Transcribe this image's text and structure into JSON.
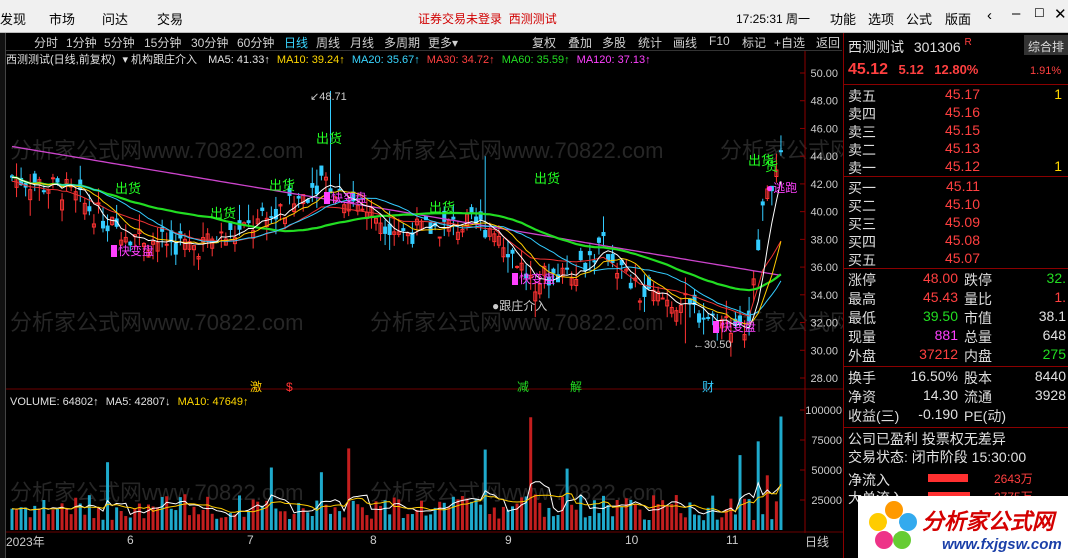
{
  "menubar": {
    "items": [
      "发现",
      "市场",
      "问达",
      "交易"
    ],
    "warning": "证券交易未登录",
    "stock_name": "西测测试",
    "clock": "17:25:31 周一",
    "right_items": [
      "功能",
      "选项",
      "公式",
      "版面"
    ]
  },
  "toolbar": {
    "periods": [
      "分时",
      "1分钟",
      "5分钟",
      "15分钟",
      "30分钟",
      "60分钟",
      "日线",
      "周线",
      "月线",
      "多周期",
      "更多▾"
    ],
    "active": "日线",
    "tools": [
      "复权",
      "叠加",
      "多股",
      "统计",
      "画线",
      "F10",
      "标记",
      "+自选",
      "返回"
    ]
  },
  "ma_line": {
    "title": "西测测试(日线,前复权)",
    "indicator": "机构跟庄介入",
    "ma5": "MA5: 41.33↑",
    "ma10": "MA10: 39.24↑",
    "ma20": "MA20: 35.67↑",
    "ma30": "MA30: 34.72↑",
    "ma60": "MA60: 35.59↑",
    "ma120": "MA120: 37.13↑"
  },
  "volume_line": {
    "volume": "VOLUME: 64802↑",
    "ma5": "MA5: 42807↓",
    "ma10": "MA10: 47649↑"
  },
  "chart_data": {
    "type": "candlestick",
    "y_price_ticks": [
      28.0,
      30.0,
      32.0,
      34.0,
      36.0,
      38.0,
      40.0,
      42.0,
      44.0,
      46.0,
      48.0,
      50.0
    ],
    "y_volume_ticks": [
      25000,
      50000,
      75000,
      100000
    ],
    "x_month_labels": [
      "2023年",
      "6",
      "7",
      "8",
      "9",
      "10",
      "11"
    ],
    "axis_label_right": "日线",
    "high_marker": "48.71",
    "low_marker": "30.50",
    "signals": {
      "sell": [
        "出货",
        "出货",
        "出货",
        "出货",
        "出货",
        "出货",
        "出货"
      ],
      "change": [
        "快变盘",
        "快变盘",
        "快变盘",
        "快变盘"
      ],
      "follow": "跟庄介入",
      "run": "逃跑",
      "events": [
        "激",
        "$",
        "减",
        "解",
        "财"
      ]
    },
    "watermark": "分析家公式网www.70822.com"
  },
  "quote": {
    "name": "西测测试",
    "code": "301306",
    "badge": "R",
    "side_tab": "综合排",
    "side_value": "1.91%",
    "price": "45.12",
    "change": "5.12",
    "pct": "12.80%",
    "asks": [
      {
        "label": "卖五",
        "price": "45.17",
        "vol": "1"
      },
      {
        "label": "卖四",
        "price": "45.16",
        "vol": ""
      },
      {
        "label": "卖三",
        "price": "45.15",
        "vol": ""
      },
      {
        "label": "卖二",
        "price": "45.13",
        "vol": ""
      },
      {
        "label": "卖一",
        "price": "45.12",
        "vol": "1"
      }
    ],
    "bids": [
      {
        "label": "买一",
        "price": "45.11"
      },
      {
        "label": "买二",
        "price": "45.10"
      },
      {
        "label": "买三",
        "price": "45.09"
      },
      {
        "label": "买四",
        "price": "45.08"
      },
      {
        "label": "买五",
        "price": "45.07"
      }
    ],
    "stats": [
      {
        "l1": "涨停",
        "v1": "48.00",
        "c1": "red",
        "l2": "跌停",
        "v2": "32.",
        "c2": "grn"
      },
      {
        "l1": "最高",
        "v1": "45.43",
        "c1": "red",
        "l2": "量比",
        "v2": "1.",
        "c2": "red"
      },
      {
        "l1": "最低",
        "v1": "39.50",
        "c1": "grn",
        "l2": "市值",
        "v2": "38.1",
        "c2": "wht"
      },
      {
        "l1": "现量",
        "v1": "881",
        "c1": "mag",
        "l2": "总量",
        "v2": "648",
        "c2": "wht"
      },
      {
        "l1": "外盘",
        "v1": "37212",
        "c1": "red",
        "l2": "内盘",
        "v2": "275",
        "c2": "grn"
      }
    ],
    "stats2": [
      {
        "l1": "换手",
        "v1": "16.50%",
        "l2": "股本",
        "v2": "8440"
      },
      {
        "l1": "净资",
        "v1": "14.30",
        "l2": "流通",
        "v2": "3928"
      },
      {
        "l1": "收益(三)",
        "v1": "-0.190",
        "l2": "PE(动)",
        "v2": ""
      }
    ],
    "profit_line": "公司已盈利 投票权无差异",
    "trade_state_label": "交易状态:",
    "trade_state": "闭市阶段 15:30:00",
    "net_inflow_label": "净流入",
    "net_inflow": "2643万",
    "big_inflow_label": "大单流入",
    "big_inflow": "2775万"
  },
  "logo": {
    "text": "分析家公式网",
    "url": "www.fxjgsw.com"
  }
}
